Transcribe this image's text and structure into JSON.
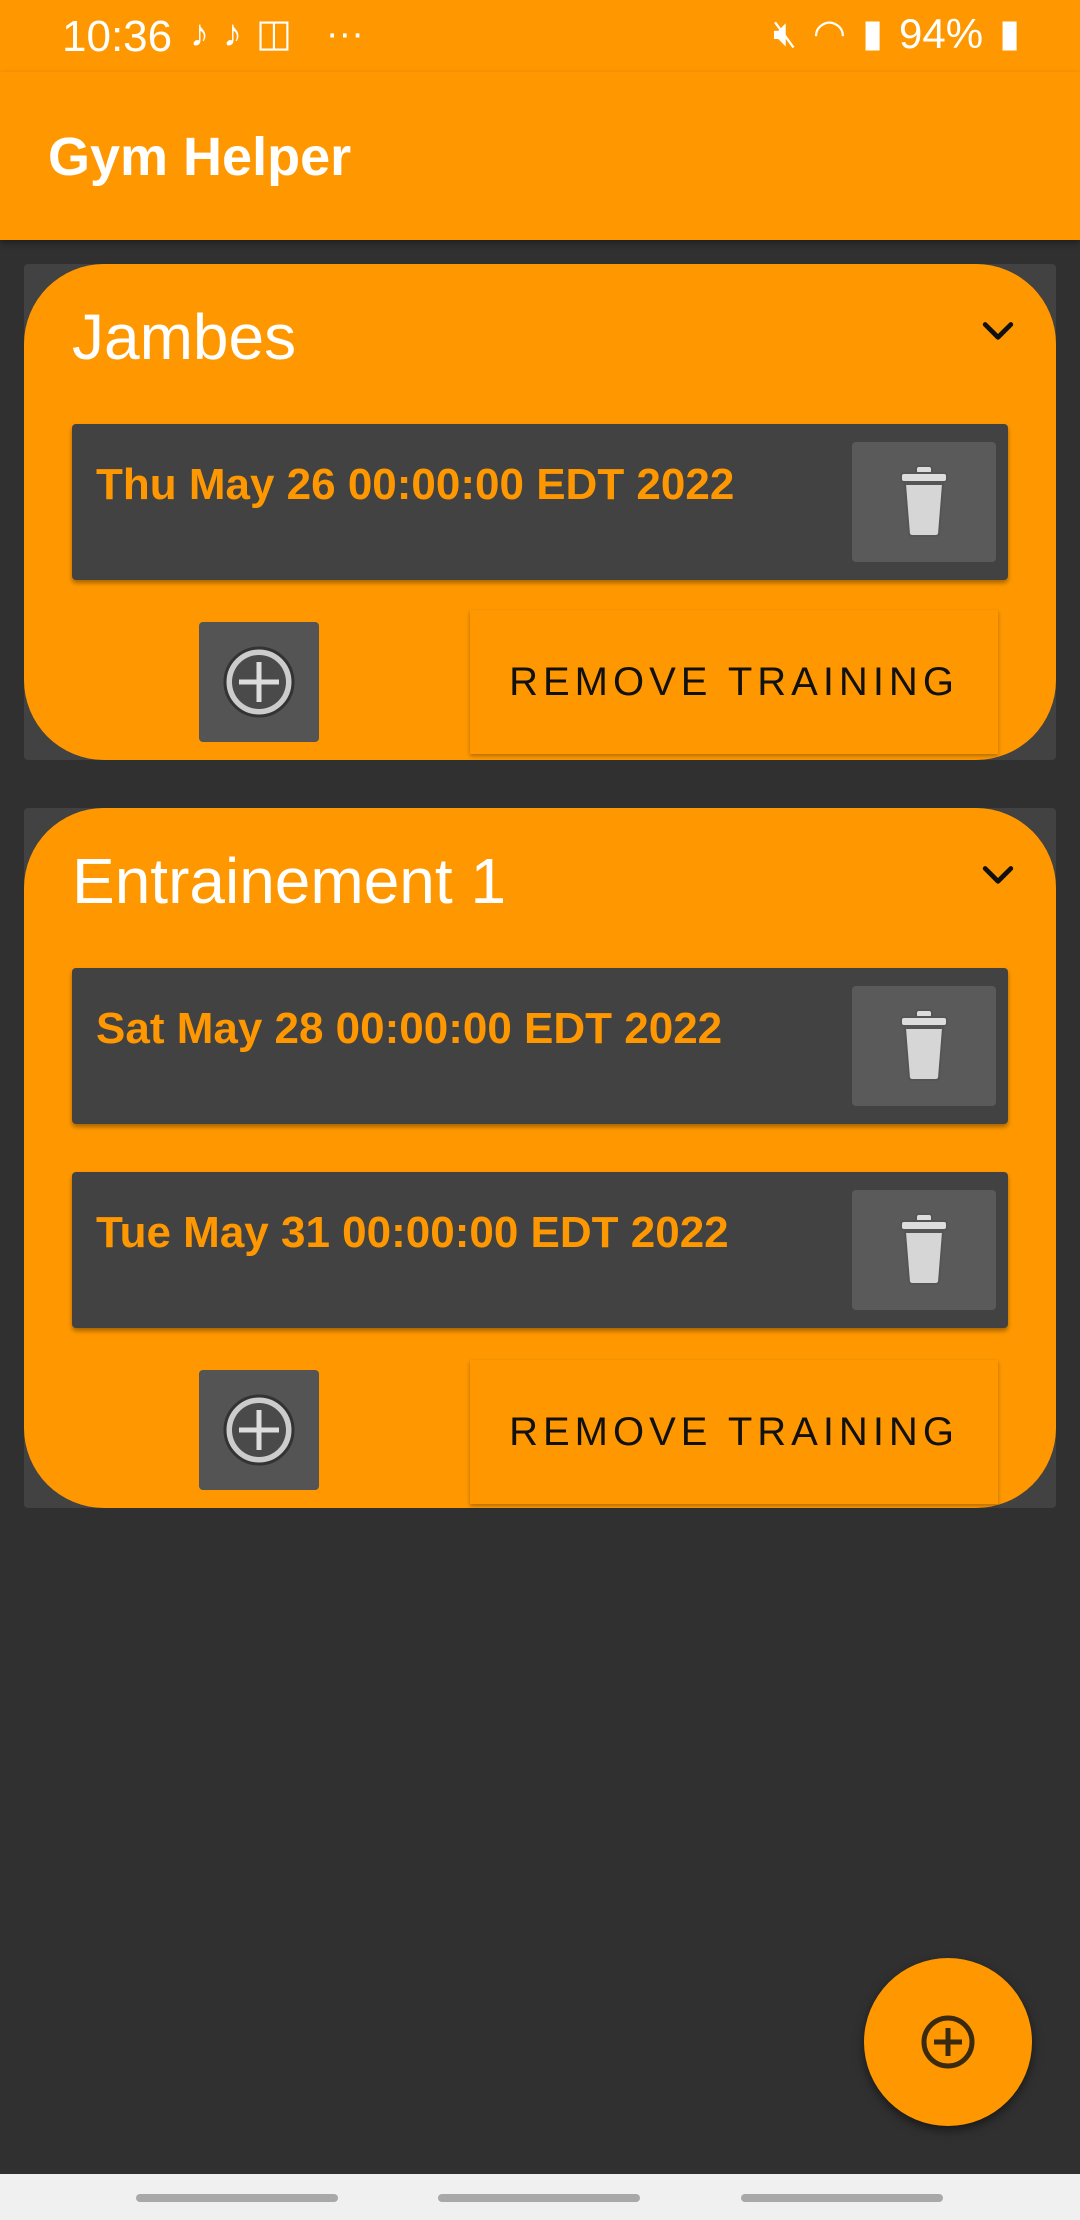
{
  "status_bar": {
    "time": "10:36",
    "notification_icons": [
      "tiktok-icon",
      "tiktok-icon",
      "twitch-icon",
      "more-icon"
    ],
    "more": "···",
    "battery": "94%"
  },
  "app_bar": {
    "title": "Gym Helper"
  },
  "trainings": [
    {
      "name": "Jambes",
      "sessions": [
        "Thu May 26 00:00:00 EDT 2022"
      ],
      "remove_label": "REMOVE TRAINING"
    },
    {
      "name": "Entrainement 1",
      "sessions": [
        "Sat May 28 00:00:00 EDT 2022",
        "Tue May 31 00:00:00 EDT 2022"
      ],
      "remove_label": "REMOVE TRAINING"
    }
  ],
  "colors": {
    "accent": "#FF9800",
    "background": "#303030",
    "session_background": "#424242"
  }
}
